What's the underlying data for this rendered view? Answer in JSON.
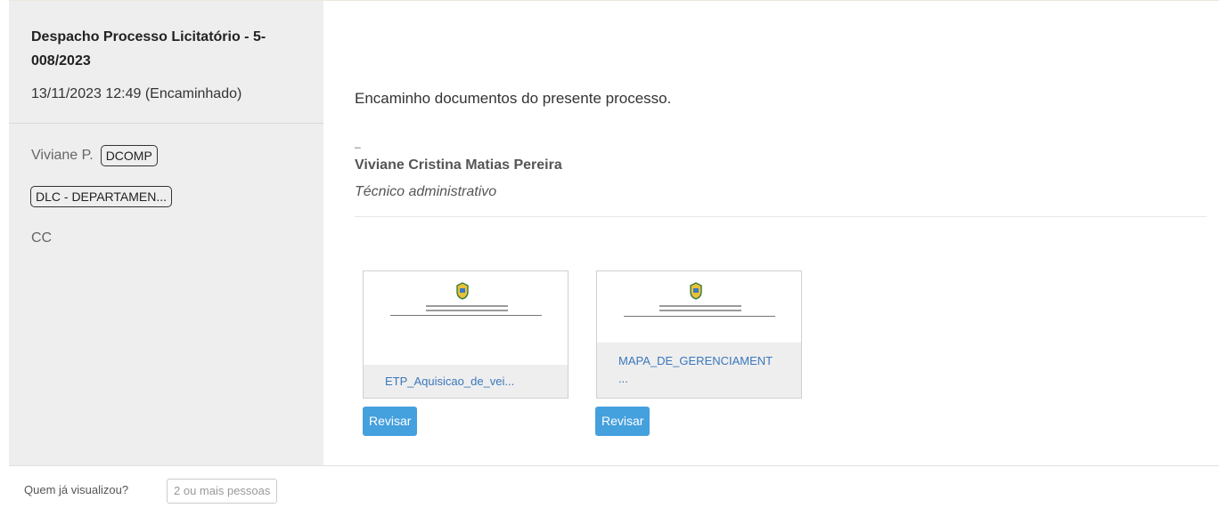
{
  "sidebar": {
    "title": "Despacho Processo Licitatório - 5- 008/2023",
    "date": "13/11/2023 12:49 (Encaminhado)",
    "author": "Viviane P.",
    "author_tag": "DCOMP",
    "department_tag": "DLC - DEPARTAMEN...",
    "cc_label": "CC"
  },
  "message": {
    "body": "Encaminho documentos do presente processo.",
    "separator": "_",
    "signature_name": "Viviane Cristina Matias Pereira",
    "signature_role": "Técnico administrativo"
  },
  "attachments": [
    {
      "name": "ETP_Aquisicao_de_vei...",
      "action": "Revisar"
    },
    {
      "name": "MAPA_DE_GERENCIAMENT ...",
      "action": "Revisar"
    }
  ],
  "footer": {
    "viewed_label": "Quem já visualizou?",
    "viewed_badge": "2 ou mais pessoas"
  },
  "colors": {
    "sidebar_bg": "#eeeeee",
    "link": "#3a77bd",
    "button": "#45a0de"
  }
}
